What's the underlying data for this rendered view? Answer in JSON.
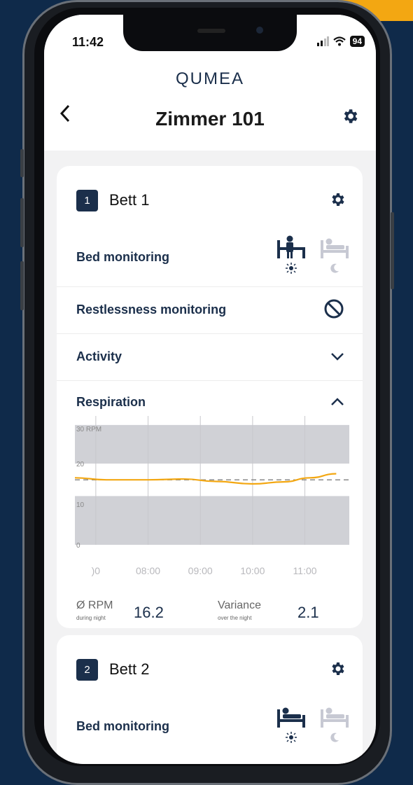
{
  "status_bar": {
    "time": "11:42",
    "battery": "94"
  },
  "header": {
    "logo": "QUMEA",
    "title": "Zimmer 101"
  },
  "beds": [
    {
      "number": "1",
      "title": "Bett 1",
      "bed_monitoring_label": "Bed monitoring",
      "restlessness_label": "Restlessness monitoring",
      "activity_label": "Activity",
      "respiration_label": "Respiration",
      "stats": {
        "avg_label": "Ø RPM",
        "avg_sub": "during night",
        "avg_value": "16.2",
        "var_label": "Variance",
        "var_sub": "over the night",
        "var_value": "2.1"
      }
    },
    {
      "number": "2",
      "title": "Bett 2",
      "bed_monitoring_label": "Bed monitoring"
    }
  ],
  "chart_data": {
    "type": "line",
    "y_unit": "30 RPM",
    "y_ticks": [
      "30 RPM",
      "20",
      "10",
      "0"
    ],
    "ylim": [
      0,
      30
    ],
    "x_ticks": [
      ")0",
      "08:00",
      "09:00",
      "10:00",
      "11:00"
    ],
    "normal_band": [
      12,
      20
    ],
    "reference_line": 16,
    "series": [
      {
        "values": [
          {
            "t": 6.0,
            "y": 16.0
          },
          {
            "t": 6.6,
            "y": 16.5
          },
          {
            "t": 7.2,
            "y": 16.0
          },
          {
            "t": 8.0,
            "y": 16.0
          },
          {
            "t": 8.7,
            "y": 16.2
          },
          {
            "t": 9.3,
            "y": 15.6
          },
          {
            "t": 10.0,
            "y": 15.0
          },
          {
            "t": 10.6,
            "y": 15.5
          },
          {
            "t": 11.1,
            "y": 16.5
          },
          {
            "t": 11.6,
            "y": 17.5
          }
        ]
      }
    ],
    "colors": {
      "series": "#f3a712",
      "band": "#d0d1d6",
      "grid": "#c8c8cc",
      "ref": "#8a8a8a"
    }
  },
  "colors": {
    "accent": "#f3a712",
    "navy": "#1b2f4b",
    "active_icon": "#1b2f4b",
    "inactive_icon": "#c7c9d3"
  }
}
